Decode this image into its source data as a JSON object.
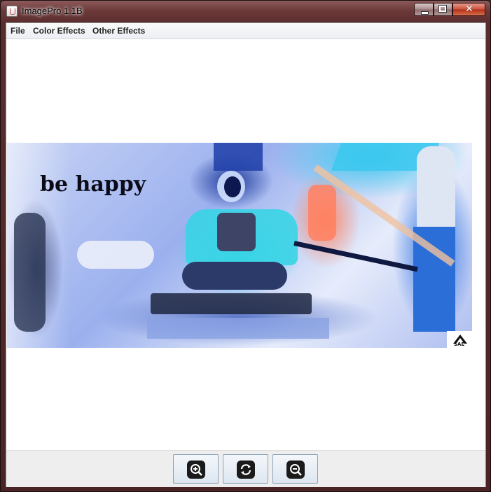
{
  "window": {
    "title": "ImagePro 1.1B"
  },
  "menubar": {
    "items": [
      {
        "label": "File"
      },
      {
        "label": "Color Effects"
      },
      {
        "label": "Other Effects"
      }
    ]
  },
  "image": {
    "caption_text": "be happy",
    "watermark_icon": "sae-logo-icon"
  },
  "toolbar": {
    "buttons": [
      {
        "icon": "zoom-in-icon"
      },
      {
        "icon": "rotate-icon"
      },
      {
        "icon": "zoom-out-icon"
      }
    ]
  },
  "colors": {
    "titlebar": "#6b3838",
    "menubar": "#eceff3",
    "toolbar": "#eeeeee",
    "button_border": "#8aa0b8"
  }
}
